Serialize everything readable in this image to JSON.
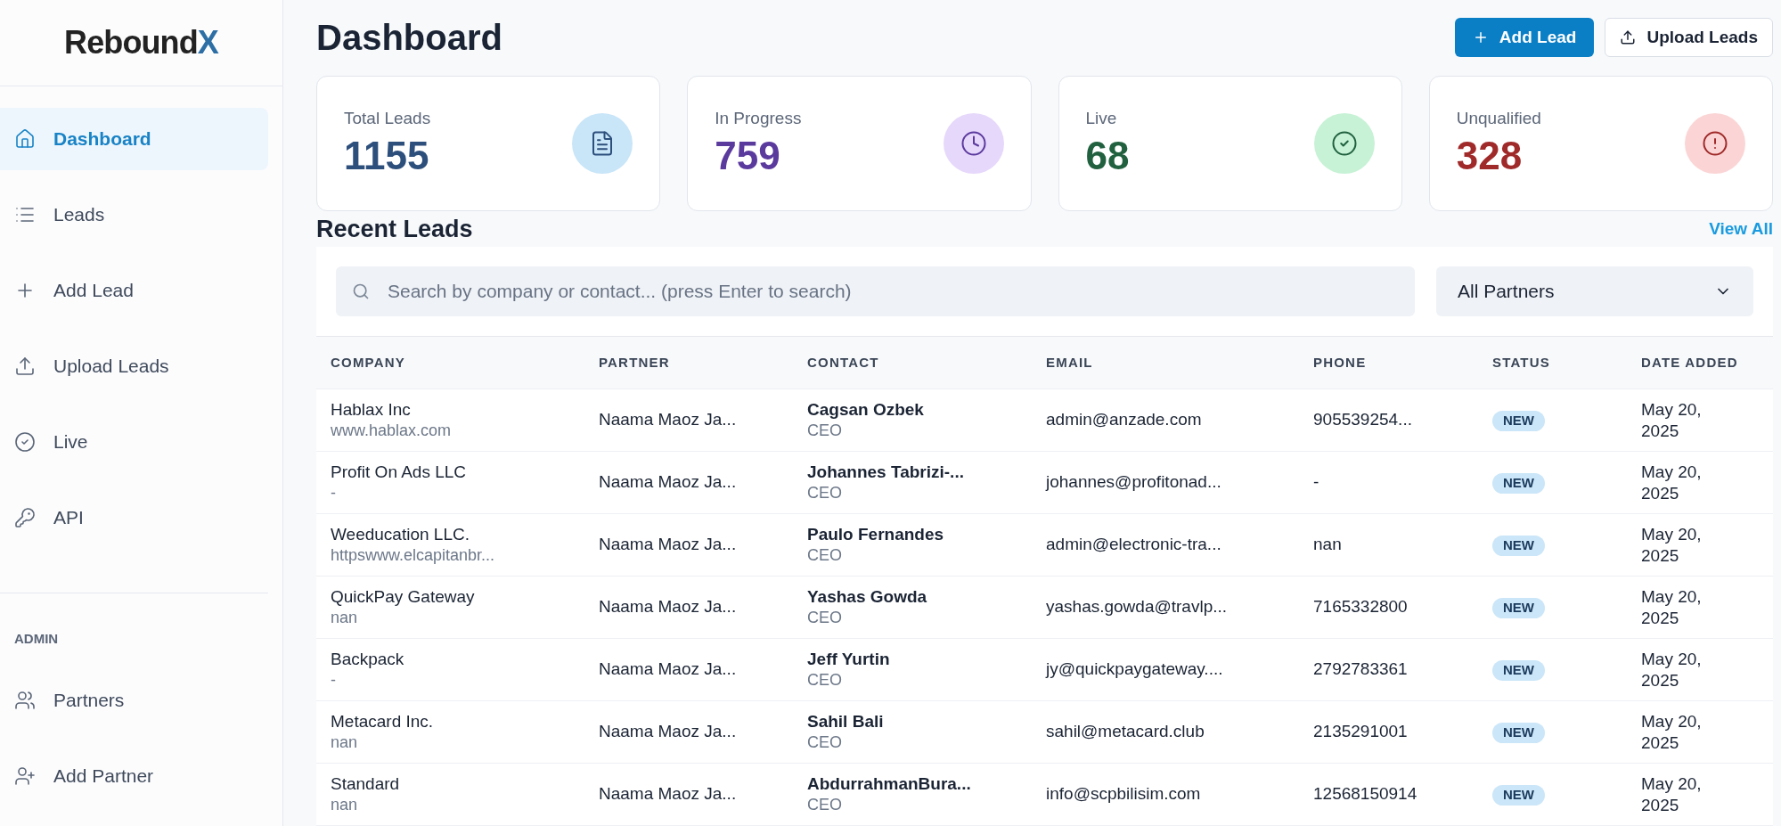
{
  "sidebar": {
    "logo": {
      "main": "Rebound",
      "accent": "X"
    },
    "items": [
      {
        "label": "Dashboard",
        "selected": true
      },
      {
        "label": "Leads",
        "selected": false
      },
      {
        "label": "Add Lead",
        "selected": false
      },
      {
        "label": "Upload Leads",
        "selected": false
      },
      {
        "label": "Live",
        "selected": false
      },
      {
        "label": "API",
        "selected": false
      }
    ],
    "admin_heading": "ADMIN",
    "admin_items": [
      {
        "label": "Partners",
        "selected": false
      },
      {
        "label": "Add Partner",
        "selected": false
      }
    ]
  },
  "header": {
    "title": "Dashboard",
    "buttons": [
      {
        "label": "Add Lead",
        "kind": "primary"
      },
      {
        "label": "Upload Leads",
        "kind": "secondary"
      }
    ]
  },
  "stats": [
    {
      "label": "Total Leads",
      "value": "1155",
      "color": "#2d4f7c"
    },
    {
      "label": "In Progress",
      "value": "759",
      "color": "#5b3a9e"
    },
    {
      "label": "Live",
      "value": "68",
      "color": "#21613f"
    },
    {
      "label": "Unqualified",
      "value": "328",
      "color": "#a02a2a"
    }
  ],
  "recent": {
    "title": "Recent Leads",
    "view_all": "View All",
    "search": {
      "placeholder": "Search by company or contact... (press Enter to search)"
    },
    "partner_filter": {
      "value": "All Partners"
    },
    "table": {
      "columns": [
        "COMPANY",
        "PARTNER",
        "CONTACT",
        "EMAIL",
        "PHONE",
        "STATUS",
        "DATE ADDED"
      ],
      "rows": [
        {
          "company": "Hablax Inc",
          "website": "www.hablax.com",
          "partner": "Naama Maoz Ja...",
          "contact": "Cagsan Ozbek",
          "role": "CEO",
          "email": "admin@anzade.com",
          "phone": "905539254...",
          "status": "NEW",
          "date": [
            "May 20,",
            "2025"
          ]
        },
        {
          "company": "Profit On Ads LLC",
          "website": "-",
          "partner": "Naama Maoz Ja...",
          "contact": "Johannes Tabrizi-...",
          "role": "CEO",
          "email": "johannes@profitonad...",
          "phone": "-",
          "status": "NEW",
          "date": [
            "May 20,",
            "2025"
          ]
        },
        {
          "company": "Weeducation LLC.",
          "website": "httpswww.elcapitanbr...",
          "partner": "Naama Maoz Ja...",
          "contact": "Paulo Fernandes",
          "role": "CEO",
          "email": "admin@electronic-tra...",
          "phone": "nan",
          "status": "NEW",
          "date": [
            "May 20,",
            "2025"
          ]
        },
        {
          "company": "QuickPay Gateway",
          "website": "nan",
          "partner": "Naama Maoz Ja...",
          "contact": "Yashas Gowda",
          "role": "CEO",
          "email": "yashas.gowda@travlp...",
          "phone": "7165332800",
          "status": "NEW",
          "date": [
            "May 20,",
            "2025"
          ]
        },
        {
          "company": "Backpack",
          "website": "-",
          "partner": "Naama Maoz Ja...",
          "contact": "Jeff Yurtin",
          "role": "CEO",
          "email": "jy@quickpaygateway....",
          "phone": "2792783361",
          "status": "NEW",
          "date": [
            "May 20,",
            "2025"
          ]
        },
        {
          "company": "Metacard Inc.",
          "website": "nan",
          "partner": "Naama Maoz Ja...",
          "contact": "Sahil Bali",
          "role": "CEO",
          "email": "sahil@metacard.club",
          "phone": "2135291001",
          "status": "NEW",
          "date": [
            "May 20,",
            "2025"
          ]
        },
        {
          "company": "Standard",
          "website": "nan",
          "partner": "Naama Maoz Ja...",
          "contact": "AbdurrahmanBura...",
          "role": "CEO",
          "email": "info@scpbilisim.com",
          "phone": "12568150914",
          "status": "NEW",
          "date": [
            "May 20,",
            "2025"
          ]
        }
      ]
    }
  }
}
